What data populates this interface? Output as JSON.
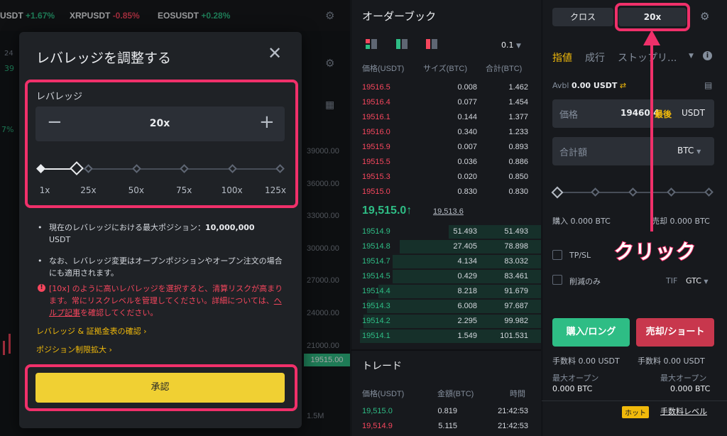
{
  "tickers": [
    {
      "sym": "USDT",
      "chg": "+1.67%",
      "up": true
    },
    {
      "sym": "XRPUSDT",
      "chg": "-0.85%",
      "up": false
    },
    {
      "sym": "EOSUSDT",
      "chg": "+0.28%",
      "up": true
    }
  ],
  "chart": {
    "axis": [
      "39000.00",
      "36000.00",
      "33000.00",
      "30000.00",
      "27000.00",
      "24000.00",
      "21000.00"
    ],
    "price_tag": "19515.00",
    "vol": "1.5M",
    "left_frag": [
      "24",
      "39",
      "7%"
    ]
  },
  "orderbook": {
    "title": "オーダーブック",
    "precision": "0.1",
    "cols": {
      "price": "価格(USDT)",
      "size": "サイズ(BTC)",
      "total": "合計(BTC)"
    },
    "asks": [
      [
        "19516.5",
        "0.008",
        "1.462"
      ],
      [
        "19516.4",
        "0.077",
        "1.454"
      ],
      [
        "19516.1",
        "0.144",
        "1.377"
      ],
      [
        "19516.0",
        "0.340",
        "1.233"
      ],
      [
        "19515.9",
        "0.007",
        "0.893"
      ],
      [
        "19515.5",
        "0.036",
        "0.886"
      ],
      [
        "19515.3",
        "0.020",
        "0.850"
      ],
      [
        "19515.0",
        "0.830",
        "0.830"
      ]
    ],
    "last": "19,515.0",
    "last_arrow": "↑",
    "mark": "19,513.6",
    "bids": [
      [
        "19514.9",
        "51.493",
        "51.493"
      ],
      [
        "19514.8",
        "27.405",
        "78.898"
      ],
      [
        "19514.7",
        "4.134",
        "83.032"
      ],
      [
        "19514.5",
        "0.429",
        "83.461"
      ],
      [
        "19514.4",
        "8.218",
        "91.679"
      ],
      [
        "19514.3",
        "6.008",
        "97.687"
      ],
      [
        "19514.2",
        "2.295",
        "99.982"
      ],
      [
        "19514.1",
        "1.549",
        "101.531"
      ]
    ],
    "bid_depth": [
      0.51,
      0.78,
      0.82,
      0.82,
      0.9,
      0.96,
      0.98,
      1.0
    ]
  },
  "trades": {
    "title": "トレード",
    "cols": {
      "price": "価格(USDT)",
      "amount": "金額(BTC)",
      "time": "時間"
    },
    "rows": [
      [
        "19,515.0",
        "0.819",
        "21:42:53",
        true
      ],
      [
        "19,514.9",
        "5.115",
        "21:42:53",
        false
      ]
    ]
  },
  "order_panel": {
    "cross": "クロス",
    "leverage": "20x",
    "tabs": [
      "指値",
      "成行",
      "ストップリ..."
    ],
    "avbl_label": "Avbl",
    "avbl": "0.00 USDT",
    "price_label": "価格",
    "price_val": "19460.4",
    "last_label": "最後",
    "price_unit": "USDT",
    "total_label": "合計額",
    "total_unit": "BTC",
    "buy_amt": "購入 0.000 BTC",
    "sell_amt": "売却 0.000 BTC",
    "tpsl": "TP/SL",
    "reduce": "削減のみ",
    "tif": "TIF",
    "gtc": "GTC",
    "buy": "購入/ロング",
    "sell": "売却/ショート",
    "fee_buy": "手数料 0.00 USDT",
    "fee_sell": "手数料 0.00 USDT",
    "max_open": "最大オープン",
    "max_buy": "0.000 BTC",
    "max_sell": "0.000 BTC",
    "hot": "ホット",
    "fee_level": "手数料レベル"
  },
  "annotation": {
    "text": "クリック"
  },
  "modal": {
    "title": "レバレッジを調整する",
    "section": "レバレッジ",
    "value": "20x",
    "marks": [
      "1x",
      "25x",
      "50x",
      "75x",
      "100x",
      "125x"
    ],
    "slider_fraction": 0.15,
    "bullet1": "現在のレバレッジにおける最大ポジション：",
    "bullet1_val": "10,000,000",
    "bullet1_unit": "USDT",
    "bullet2": "なお、レバレッジ変更はオープンポジションやオープン注文の場合にも適用されます。",
    "warn_a": "[10x] のように高いレバレッジを選択すると、清算リスクが高まります。常にリスクレベルを管理してください。詳細については、",
    "warn_link": "ヘルプ記事",
    "warn_b": "を確認してください。",
    "link1": "レバレッジ & 証拠金表の確認",
    "link2": "ポジション制限拡大",
    "confirm": "承認",
    "colors": {
      "accent": "#f0b90b",
      "highlight": "#f0306a",
      "green": "#2ebd85",
      "red": "#f6465d"
    }
  }
}
